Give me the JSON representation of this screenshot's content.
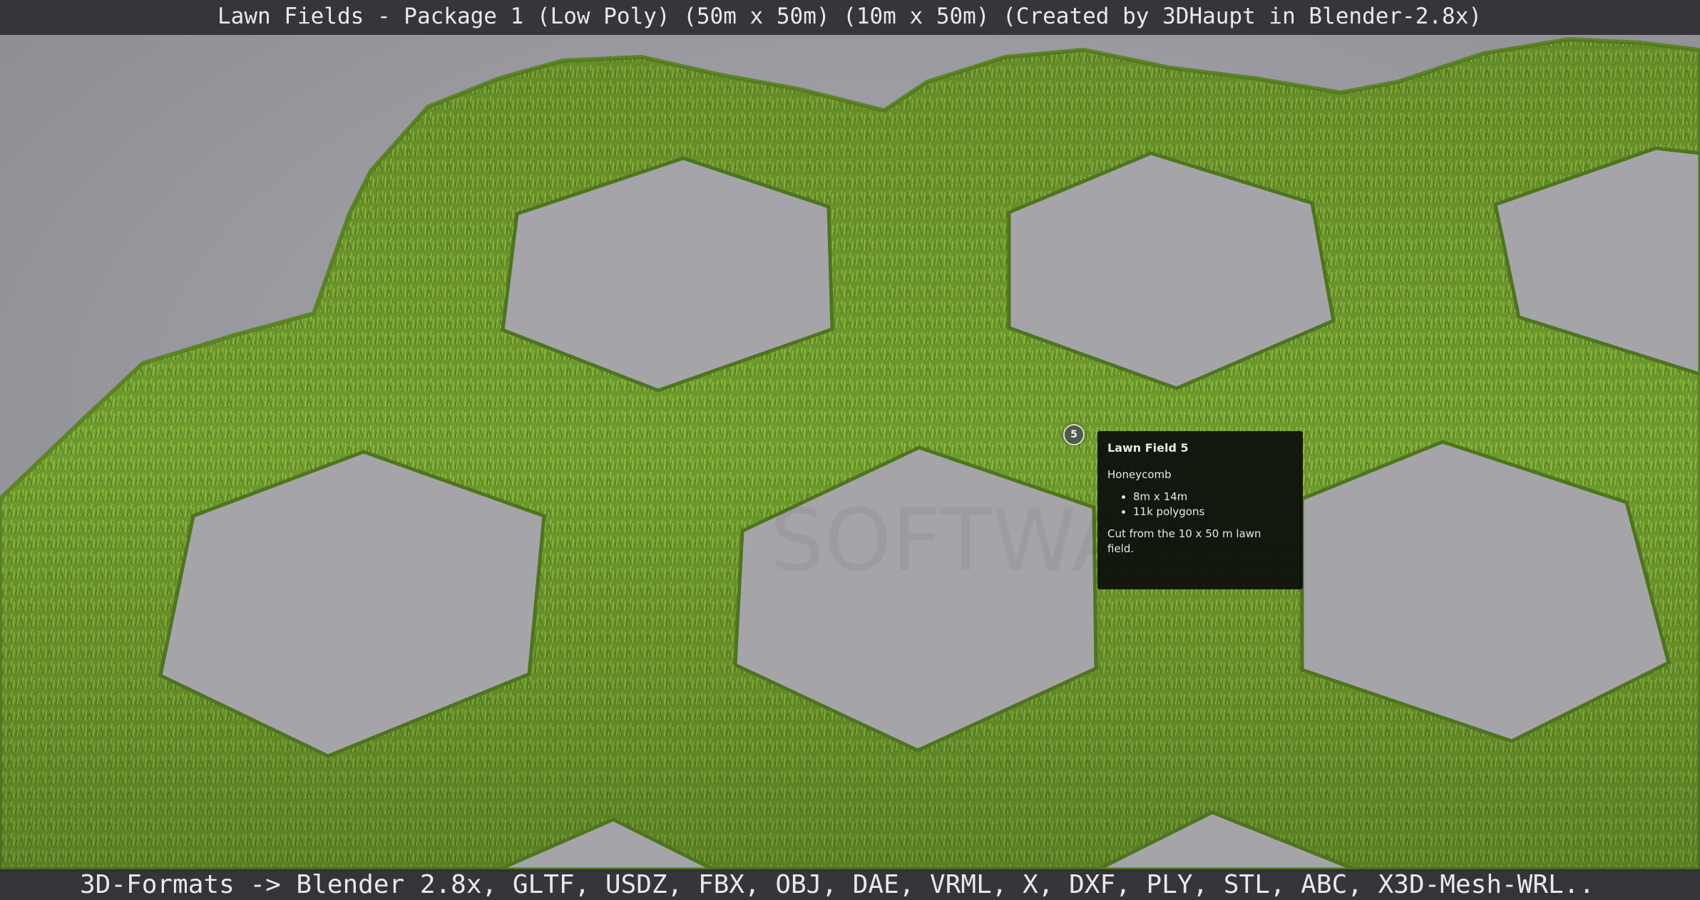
{
  "header": {
    "title": "Lawn Fields - Package 1 (Low Poly) (50m x 50m) (10m x 50m) (Created by 3DHaupt in Blender-2.8x)"
  },
  "footer": {
    "formats": "3D-Formats -> Blender 2.8x, GLTF, USDZ, FBX, OBJ, DAE, VRML, X, DXF, PLY, STL, ABC, X3D-Mesh-WRL.."
  },
  "scene": {
    "background_color": "#a4a4aa",
    "lawn_color": "#6f9a2c",
    "lawn_highlight_color": "#8fbc3e",
    "cutout_color": "#a5a5a9"
  },
  "annotation": {
    "hotspot_number": "5",
    "title": "Lawn Field 5",
    "subtitle": "Honeycomb",
    "specs": [
      "8m x 14m",
      "11k polygons"
    ],
    "note": "Cut from the 10 x 50 m lawn field."
  }
}
